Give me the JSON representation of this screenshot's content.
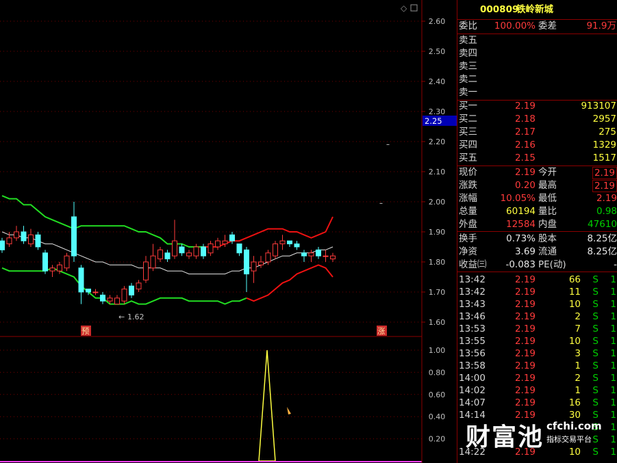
{
  "stock": {
    "code": "000809",
    "name": "铁岭新城"
  },
  "order_ratio": {
    "label_ratio": "委比",
    "ratio": "100.00%",
    "label_diff": "委差",
    "diff": "91.9万"
  },
  "asks": [
    {
      "label": "卖五",
      "price": "",
      "vol": ""
    },
    {
      "label": "卖四",
      "price": "",
      "vol": ""
    },
    {
      "label": "卖三",
      "price": "",
      "vol": ""
    },
    {
      "label": "卖二",
      "price": "",
      "vol": ""
    },
    {
      "label": "卖一",
      "price": "",
      "vol": ""
    }
  ],
  "bids": [
    {
      "label": "买一",
      "price": "2.19",
      "vol": "913107"
    },
    {
      "label": "买二",
      "price": "2.18",
      "vol": "2957"
    },
    {
      "label": "买三",
      "price": "2.17",
      "vol": "275"
    },
    {
      "label": "买四",
      "price": "2.16",
      "vol": "1329"
    },
    {
      "label": "买五",
      "price": "2.15",
      "vol": "1517"
    }
  ],
  "quote": [
    {
      "l1": "现价",
      "v1": "2.19",
      "c1": "red",
      "l2": "今开",
      "v2": "2.19",
      "c2": "red",
      "box": true
    },
    {
      "l1": "涨跌",
      "v1": "0.20",
      "c1": "red",
      "l2": "最高",
      "v2": "2.19",
      "c2": "red",
      "box": true
    },
    {
      "l1": "涨幅",
      "v1": "10.05%",
      "c1": "red",
      "l2": "最低",
      "v2": "2.19",
      "c2": "red",
      "box": false
    },
    {
      "l1": "总量",
      "v1": "60194",
      "c1": "yel",
      "l2": "量比",
      "v2": "0.98",
      "c2": "grn",
      "box": false
    },
    {
      "l1": "外盘",
      "v1": "12584",
      "c1": "red",
      "l2": "内盘",
      "v2": "47610",
      "c2": "grn",
      "box": false
    },
    {
      "l1": "换手",
      "v1": "0.73%",
      "c1": "wht",
      "l2": "股本",
      "v2": "8.25亿",
      "c2": "wht",
      "box": false
    },
    {
      "l1": "净资",
      "v1": "3.69",
      "c1": "wht",
      "l2": "流通",
      "v2": "8.25亿",
      "c2": "wht",
      "box": false
    },
    {
      "l1": "收益㈢",
      "v1": "-0.083",
      "c1": "wht",
      "l2": "PE(动)",
      "v2": "-",
      "c2": "wht",
      "box": false
    }
  ],
  "ticks": [
    {
      "time": "13:42",
      "price": "2.19",
      "vol": "66",
      "side": "S",
      "n": "1"
    },
    {
      "time": "13:42",
      "price": "2.19",
      "vol": "11",
      "side": "S",
      "n": "1"
    },
    {
      "time": "13:43",
      "price": "2.19",
      "vol": "10",
      "side": "S",
      "n": "1"
    },
    {
      "time": "13:46",
      "price": "2.19",
      "vol": "2",
      "side": "S",
      "n": "1"
    },
    {
      "time": "13:53",
      "price": "2.19",
      "vol": "7",
      "side": "S",
      "n": "1"
    },
    {
      "time": "13:55",
      "price": "2.19",
      "vol": "10",
      "side": "S",
      "n": "1"
    },
    {
      "time": "13:56",
      "price": "2.19",
      "vol": "3",
      "side": "S",
      "n": "1"
    },
    {
      "time": "13:58",
      "price": "2.19",
      "vol": "1",
      "side": "S",
      "n": "1"
    },
    {
      "time": "14:00",
      "price": "2.19",
      "vol": "2",
      "side": "S",
      "n": "1"
    },
    {
      "time": "14:02",
      "price": "2.19",
      "vol": "1",
      "side": "S",
      "n": "1"
    },
    {
      "time": "14:07",
      "price": "2.19",
      "vol": "16",
      "side": "S",
      "n": "1"
    },
    {
      "time": "14:14",
      "price": "2.19",
      "vol": "30",
      "side": "S",
      "n": "1"
    },
    {
      "time": "",
      "price": "",
      "vol": "",
      "side": "S",
      "n": "1"
    },
    {
      "time": "",
      "price": "",
      "vol": "",
      "side": "S",
      "n": "1"
    },
    {
      "time": "14:22",
      "price": "2.19",
      "vol": "10",
      "side": "S",
      "n": "1"
    }
  ],
  "chart": {
    "price_ticks": [
      "2.60",
      "2.50",
      "2.40",
      "2.30",
      "2.20",
      "2.10",
      "2.00",
      "1.90",
      "1.80",
      "1.70",
      "1.60"
    ],
    "current_price_tag": "2.25",
    "low_annotation": "1.62",
    "marker_left": "预",
    "marker_right": "涨",
    "indicator_ticks": [
      "1.00",
      "0.80",
      "0.60",
      "0.40",
      "0.20"
    ]
  },
  "watermark": {
    "brand": "财富池",
    "domain": "cfchi.com",
    "tagline": "指标交易平台"
  },
  "chart_data": {
    "type": "candlestick",
    "ylim": [
      1.57,
      2.63
    ],
    "candles": [
      [
        1.87,
        1.84,
        1.88,
        1.83
      ],
      [
        1.86,
        1.88,
        1.9,
        1.85
      ],
      [
        1.88,
        1.9,
        1.92,
        1.87
      ],
      [
        1.9,
        1.87,
        1.92,
        1.86
      ],
      [
        1.86,
        1.89,
        1.91,
        1.85
      ],
      [
        1.89,
        1.85,
        1.9,
        1.84
      ],
      [
        1.83,
        1.77,
        1.84,
        1.76
      ],
      [
        1.77,
        1.78,
        1.79,
        1.75
      ],
      [
        1.77,
        1.79,
        1.8,
        1.76
      ],
      [
        1.78,
        1.82,
        1.83,
        1.77
      ],
      [
        1.95,
        1.82,
        2.0,
        1.8
      ],
      [
        1.78,
        1.7,
        1.79,
        1.66
      ],
      [
        1.71,
        1.7,
        1.71,
        1.69
      ],
      [
        1.7,
        1.7,
        1.71,
        1.69
      ],
      [
        1.69,
        1.67,
        1.7,
        1.66
      ],
      [
        1.67,
        1.68,
        1.69,
        1.66
      ],
      [
        1.66,
        1.68,
        1.69,
        1.66
      ],
      [
        1.67,
        1.71,
        1.72,
        1.66
      ],
      [
        1.72,
        1.69,
        1.73,
        1.68
      ],
      [
        1.71,
        1.73,
        1.74,
        1.7
      ],
      [
        1.74,
        1.8,
        1.82,
        1.73
      ],
      [
        1.78,
        1.82,
        1.86,
        1.77
      ],
      [
        1.81,
        1.84,
        1.85,
        1.8
      ],
      [
        1.83,
        1.81,
        1.84,
        1.8
      ],
      [
        1.82,
        1.87,
        1.94,
        1.81
      ],
      [
        1.85,
        1.83,
        1.86,
        1.82
      ],
      [
        1.82,
        1.83,
        1.84,
        1.81
      ],
      [
        1.82,
        1.85,
        1.86,
        1.81
      ],
      [
        1.85,
        1.82,
        1.86,
        1.81
      ],
      [
        1.83,
        1.86,
        1.87,
        1.82
      ],
      [
        1.85,
        1.87,
        1.88,
        1.84
      ],
      [
        1.86,
        1.87,
        1.89,
        1.85
      ],
      [
        1.89,
        1.87,
        1.9,
        1.86
      ],
      [
        1.86,
        1.83,
        1.86,
        1.82
      ],
      [
        1.84,
        1.76,
        1.85,
        1.7
      ],
      [
        1.77,
        1.8,
        1.82,
        1.73
      ],
      [
        1.79,
        1.8,
        1.82,
        1.78
      ],
      [
        1.8,
        1.83,
        1.84,
        1.79
      ],
      [
        1.82,
        1.86,
        1.87,
        1.81
      ],
      [
        1.86,
        1.87,
        1.89,
        1.84
      ],
      [
        1.87,
        1.86,
        1.87,
        1.85
      ],
      [
        1.86,
        1.85,
        1.87,
        1.84
      ],
      [
        1.83,
        1.82,
        1.84,
        1.8
      ],
      [
        1.82,
        1.83,
        1.84,
        1.8
      ],
      [
        1.84,
        1.82,
        1.85,
        1.81
      ],
      [
        1.82,
        1.82,
        1.84,
        1.8
      ],
      [
        1.81,
        1.82,
        1.83,
        1.8
      ]
    ],
    "band_mid": [
      1.9,
      1.89,
      1.89,
      1.88,
      1.88,
      1.87,
      1.86,
      1.86,
      1.85,
      1.84,
      1.83,
      1.82,
      1.81,
      1.8,
      1.8,
      1.79,
      1.79,
      1.79,
      1.79,
      1.78,
      1.78,
      1.78,
      1.78,
      1.77,
      1.77,
      1.77,
      1.76,
      1.76,
      1.76,
      1.76,
      1.76,
      1.76,
      1.77,
      1.77,
      1.78,
      1.78,
      1.79,
      1.8,
      1.81,
      1.82,
      1.82,
      1.83,
      1.83,
      1.83,
      1.84,
      1.84,
      1.85
    ],
    "indicator": {
      "ylim": [
        0,
        1.1
      ],
      "peak_index": 34,
      "peak_value": 1.0
    }
  }
}
